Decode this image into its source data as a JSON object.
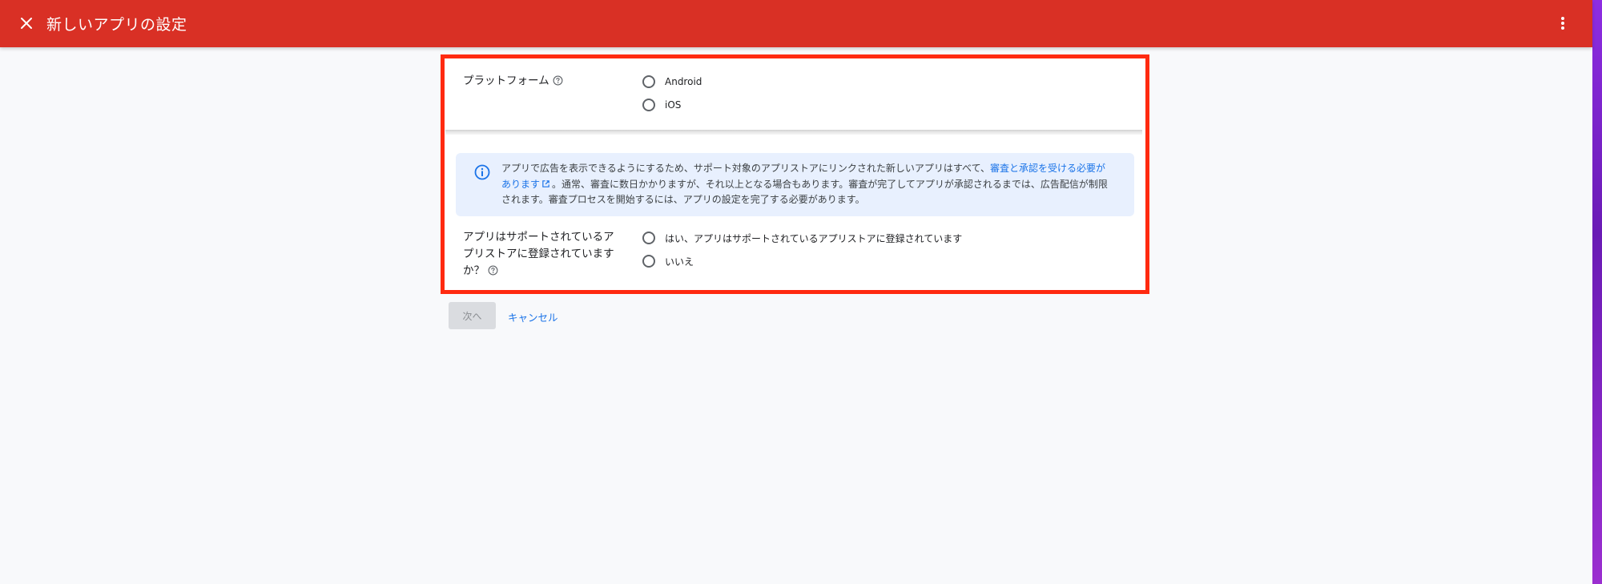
{
  "header": {
    "title": "新しいアプリの設定",
    "close_icon": "close-icon",
    "more_icon": "more-vert-icon",
    "background_color": "#d93025"
  },
  "platform": {
    "label": "プラットフォーム",
    "help_icon": "help-circle-icon",
    "options": [
      {
        "label": "Android",
        "selected": false
      },
      {
        "label": "iOS",
        "selected": false
      }
    ]
  },
  "info": {
    "icon": "info-icon",
    "text_before_link": "アプリで広告を表示できるようにするため、サポート対象のアプリストアにリンクされた新しいアプリはすべて、",
    "link_text": "審査と承認を受ける必要があります",
    "link_icon": "open-in-new-icon",
    "text_after_link": "。通常、審査に数日かかりますが、それ以上となる場合もあります。審査が完了してアプリが承認されるまでは、広告配信が制限されます。審査プロセスを開始するには、アプリの設定を完了する必要があります。",
    "link_color": "#1a73e8",
    "background_color": "#e8f0fe"
  },
  "store_question": {
    "label": "アプリはサポートされているアプリストアに登録されていますか？",
    "help_icon": "help-circle-icon",
    "options": [
      {
        "label": "はい、アプリはサポートされているアプリストアに登録されています",
        "selected": false
      },
      {
        "label": "いいえ",
        "selected": false
      }
    ]
  },
  "actions": {
    "next_label": "次へ",
    "next_disabled": true,
    "cancel_label": "キャンセル"
  },
  "highlight_color": "#ff2a10"
}
